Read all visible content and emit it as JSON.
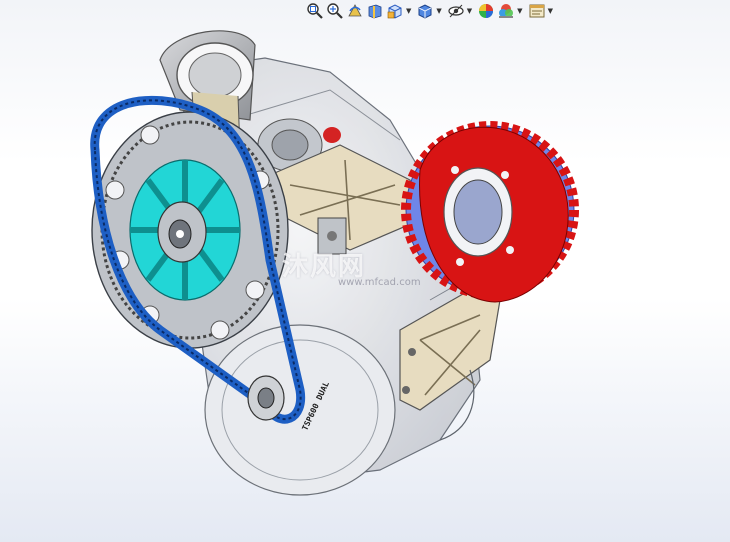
{
  "toolbar": {
    "buttons": [
      {
        "name": "zoom-to-fit",
        "icon": "zoom-fit-icon",
        "dropdown": false
      },
      {
        "name": "zoom-to-area",
        "icon": "zoom-area-icon",
        "dropdown": false
      },
      {
        "name": "previous-view",
        "icon": "previous-view-icon",
        "dropdown": false
      },
      {
        "name": "section-view",
        "icon": "section-view-icon",
        "dropdown": false
      },
      {
        "name": "view-orientation",
        "icon": "view-orientation-icon",
        "dropdown": true
      },
      {
        "name": "display-style",
        "icon": "display-style-icon",
        "dropdown": true
      },
      {
        "name": "hide-show-items",
        "icon": "hide-show-icon",
        "dropdown": true
      },
      {
        "name": "edit-appearance",
        "icon": "appearance-icon",
        "dropdown": false
      },
      {
        "name": "apply-scene",
        "icon": "scene-icon",
        "dropdown": true
      },
      {
        "name": "view-settings",
        "icon": "view-settings-icon",
        "dropdown": true
      }
    ]
  },
  "model": {
    "engraving": "TSP600 DUAL",
    "colors": {
      "chain": "#1e5fc4",
      "hub": "#22d6d6",
      "rear_sprocket": "#d81414",
      "sprocket_edge": "#6f86e8",
      "housing": "#d7d9de",
      "bracket": "#e7dcc0"
    }
  },
  "watermark": {
    "text": "沐风网",
    "sub": "www.mfcad.com"
  }
}
